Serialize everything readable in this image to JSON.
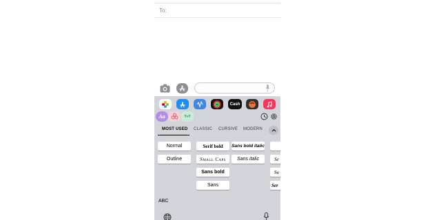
{
  "compose": {
    "to_label": "To:",
    "message_placeholder": ""
  },
  "apps": [
    {
      "name": "photos-app-icon",
      "label": "",
      "color": "#ffffff"
    },
    {
      "name": "app-store-icon",
      "label": "",
      "color": "#1e8cf0"
    },
    {
      "name": "audio-message-icon",
      "label": "",
      "color": "#3f86e6"
    },
    {
      "name": "fitness-icon",
      "label": "",
      "color": "#111111"
    },
    {
      "name": "apple-cash-icon",
      "label": "Cash",
      "color": "#111111"
    },
    {
      "name": "memoji-icon",
      "label": "",
      "color": "#2e2e2e"
    },
    {
      "name": "music-app-icon",
      "label": "",
      "color": "#f5375a"
    }
  ],
  "apps_row2": [
    {
      "name": "fonts-app-icon",
      "label": "Aa",
      "color": "#b58ce8"
    },
    {
      "name": "flower-app-icon",
      "label": "",
      "color": "#f2d3d8"
    },
    {
      "name": "text-app-icon",
      "label": "T+T",
      "color": "#c8ecd8"
    }
  ],
  "tabs": [
    {
      "label": "MOST USED",
      "active": true
    },
    {
      "label": "CLASSIC",
      "active": false
    },
    {
      "label": "CURSIVE",
      "active": false
    },
    {
      "label": "MODERN",
      "active": false
    }
  ],
  "font_styles": {
    "col1": [
      "Normal",
      "Outline"
    ],
    "col2": [
      "Serif bold",
      "Small Caps",
      "Sans bold",
      "Sans"
    ],
    "col3": [
      "Sans bold italic",
      "Sans italic"
    ],
    "col4": [
      "",
      "Se",
      "Se",
      "Ser"
    ]
  },
  "keyboard": {
    "abc_label": "ABC"
  }
}
